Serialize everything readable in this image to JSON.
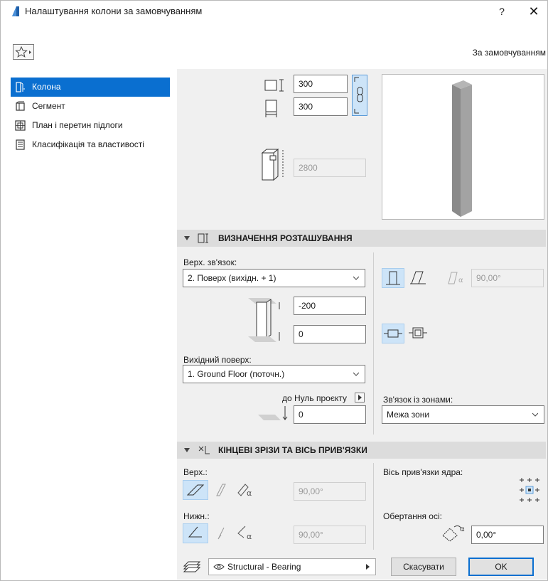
{
  "window": {
    "title": "Налаштування колони за замовчуванням",
    "help": "?",
    "close": "✕"
  },
  "preset": {
    "label": "За замовчуванням"
  },
  "nav": {
    "items": [
      {
        "label": "Колона",
        "icon": "column-icon",
        "selected": true
      },
      {
        "label": "Сегмент",
        "icon": "segment-icon",
        "selected": false
      },
      {
        "label": "План і перетин підлоги",
        "icon": "floor-plan-icon",
        "selected": false
      },
      {
        "label": "Класифікація та властивості",
        "icon": "classification-icon",
        "selected": false
      }
    ]
  },
  "geometry": {
    "width": "300",
    "depth": "300",
    "height": "2800"
  },
  "positioning": {
    "title": "ВИЗНАЧЕННЯ РОЗТАШУВАННЯ",
    "top_link_label": "Верх. зв'язок:",
    "top_link_value": "2. Поверх (вихідн. + 1)",
    "top_offset": "-200",
    "bottom_offset": "0",
    "home_story_label": "Вихідний поверх:",
    "home_story_value": "1. Ground Floor (поточн.)",
    "project_zero_label": "до Нуль проєкту",
    "project_zero_value": "0",
    "slant_angle": "90,00°",
    "zone_relation_label": "Зв'язок із зонами:",
    "zone_relation_value": "Межа зони"
  },
  "end_cuts": {
    "title": "КІНЦЕВІ ЗРІЗИ ТА ВІСЬ ПРИВ'ЯЗКИ",
    "top_label": "Верх.:",
    "top_angle": "90,00°",
    "bottom_label": "Нижн.:",
    "bottom_angle": "90,00°",
    "anchor_label": "Вісь прив'язки ядра:",
    "rotation_label": "Обертання осі:",
    "rotation_value": "0,00°"
  },
  "footer": {
    "layer": "Structural - Bearing",
    "cancel": "Скасувати",
    "ok": "OK"
  },
  "colors": {
    "accent": "#0a6fd0",
    "active_toggle": "#cde4f8",
    "panel_bg": "#f0f0f0"
  }
}
